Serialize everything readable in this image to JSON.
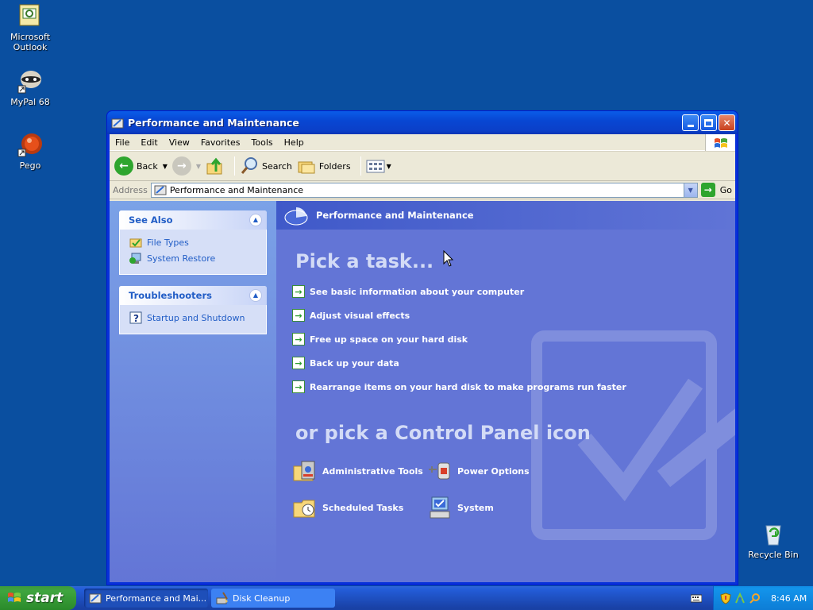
{
  "desktop": {
    "icons": [
      {
        "label": "Microsoft Outlook",
        "icon": "outlook-icon"
      },
      {
        "label": "MyPal 68",
        "icon": "mypal-icon"
      },
      {
        "label": "Pego",
        "icon": "pego-icon"
      },
      {
        "label": "Recycle Bin",
        "icon": "recycle-bin-icon"
      }
    ]
  },
  "window": {
    "title": "Performance and Maintenance",
    "menu": [
      "File",
      "Edit",
      "View",
      "Favorites",
      "Tools",
      "Help"
    ],
    "toolbar": {
      "back": "Back",
      "search": "Search",
      "folders": "Folders"
    },
    "address": {
      "label": "Address",
      "value": "Performance and Maintenance",
      "go": "Go"
    }
  },
  "sidebar": {
    "see_also": {
      "title": "See Also",
      "items": [
        "File Types",
        "System Restore"
      ]
    },
    "troubleshooters": {
      "title": "Troubleshooters",
      "items": [
        "Startup and Shutdown"
      ]
    }
  },
  "main": {
    "header": "Performance and Maintenance",
    "pick_task": "Pick a task...",
    "tasks": [
      "See basic information about your computer",
      "Adjust visual effects",
      "Free up space on your hard disk",
      "Back up your data",
      "Rearrange items on your hard disk to make programs run faster"
    ],
    "or_pick": "or pick a Control Panel icon",
    "icons": [
      {
        "label": "Administrative Tools",
        "icon": "administrative-tools-icon"
      },
      {
        "label": "Power Options",
        "icon": "power-options-icon"
      },
      {
        "label": "Scheduled Tasks",
        "icon": "scheduled-tasks-icon"
      },
      {
        "label": "System",
        "icon": "system-icon"
      }
    ]
  },
  "taskbar": {
    "start": "start",
    "tasks": [
      {
        "label": "Performance and Mai...",
        "active": true
      },
      {
        "label": "Disk Cleanup",
        "active": false
      }
    ],
    "clock": "8:46 AM"
  },
  "colors": {
    "desktop": "#0a4fa0",
    "title_bar": "#0847d3",
    "main_pane": "#6375d6",
    "link": "#215dc6",
    "start_green": "#3fa53f"
  }
}
